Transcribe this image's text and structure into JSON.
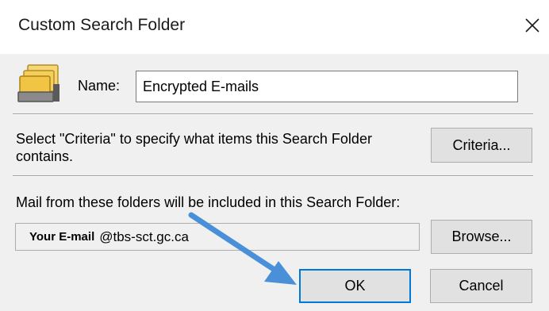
{
  "window": {
    "title": "Custom Search Folder",
    "close_symbol": "✕"
  },
  "name_row": {
    "icon": "folder-stack-icon",
    "label": "Name:",
    "value": "Encrypted E-mails"
  },
  "criteria": {
    "text": "Select \"Criteria\" to specify what items this Search Folder contains.",
    "button_label": "Criteria..."
  },
  "folders": {
    "text": "Mail from these folders will be included in this Search Folder:",
    "folder_bold": "Your E-mail",
    "folder_rest": "@tbs-sct.gc.ca",
    "browse_label": "Browse..."
  },
  "footer": {
    "ok_label": "OK",
    "cancel_label": "Cancel"
  },
  "colors": {
    "accent": "#0078d7",
    "annotation_arrow": "#4a90d9",
    "dialog_body": "#f0f0f0"
  }
}
